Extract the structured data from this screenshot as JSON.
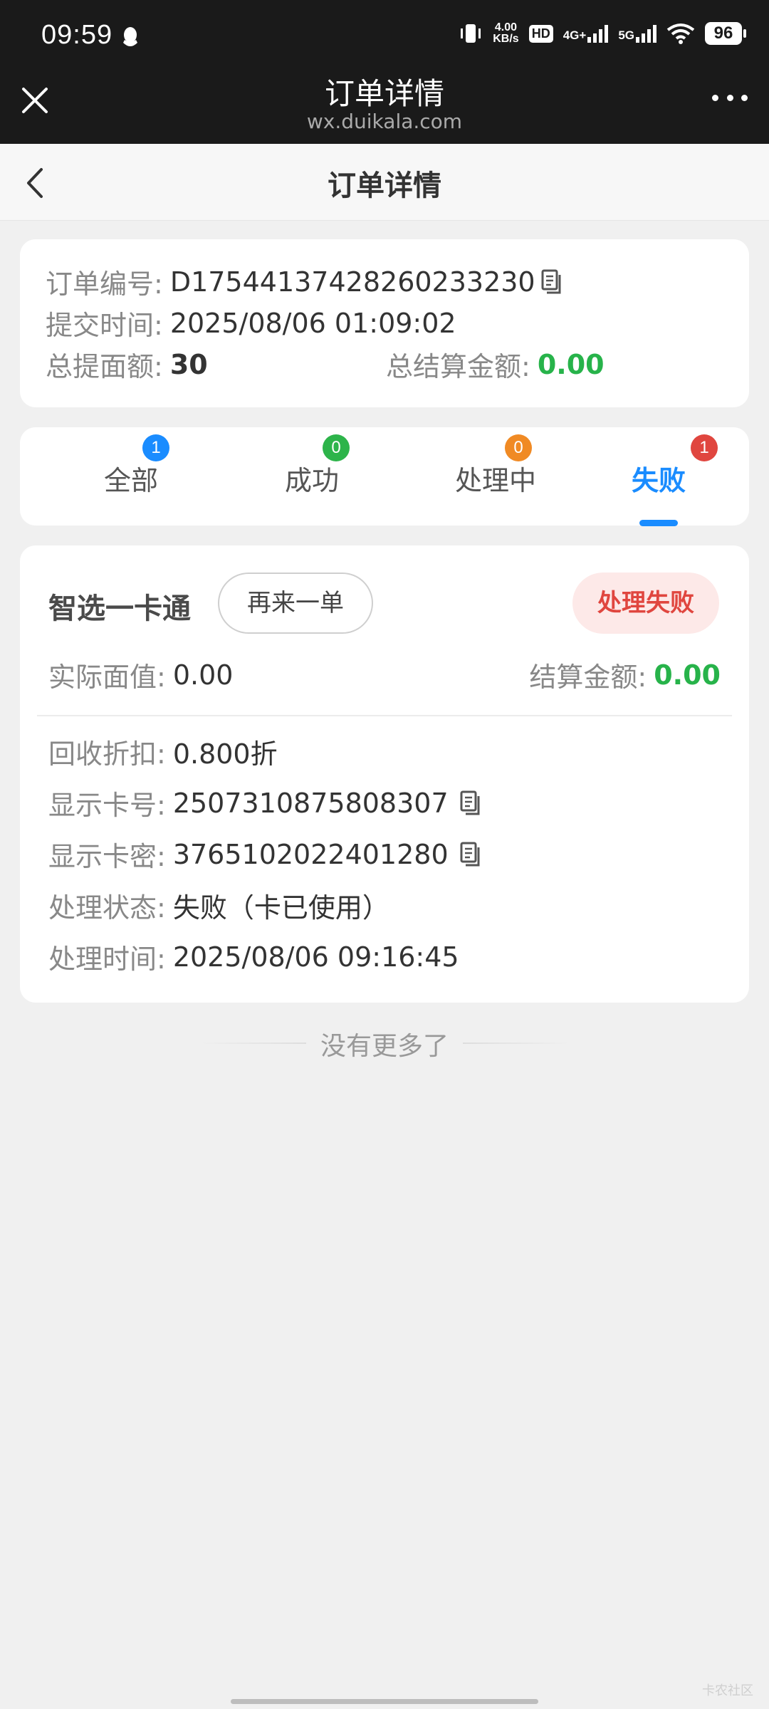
{
  "status_bar": {
    "time": "09:59",
    "net_speed_value": "4.00",
    "net_speed_unit": "KB/s",
    "hd_label": "HD",
    "sim1": "4G+",
    "sim2": "5G",
    "battery": "96"
  },
  "browser": {
    "title": "订单详情",
    "url": "wx.duikala.com"
  },
  "page": {
    "title": "订单详情"
  },
  "order_info": {
    "order_no_label": "订单编号:",
    "order_no": "D17544137428260233230",
    "submit_time_label": "提交时间:",
    "submit_time": "2025/08/06 01:09:02",
    "total_face_label": "总提面额:",
    "total_face": "30",
    "total_settle_label": "总结算金额:",
    "total_settle": "0.00"
  },
  "tabs": [
    {
      "label": "全部",
      "count": "1",
      "color": "#1a8cff"
    },
    {
      "label": "成功",
      "count": "0",
      "color": "#2db44a"
    },
    {
      "label": "处理中",
      "count": "0",
      "color": "#f08a24"
    },
    {
      "label": "失败",
      "count": "1",
      "color": "#e0463f",
      "active": true
    }
  ],
  "card": {
    "name": "智选一卡通",
    "reorder_label": "再来一单",
    "status": "处理失败",
    "actual_face_label": "实际面值:",
    "actual_face": "0.00",
    "settle_label": "结算金额:",
    "settle": "0.00",
    "discount_label": "回收折扣:",
    "discount": "0.800折",
    "card_no_label": "显示卡号:",
    "card_no": "2507310875808307",
    "card_pwd_label": "显示卡密:",
    "card_pwd": "3765102022401280",
    "state_label": "处理状态:",
    "state": "失败（卡已使用）",
    "process_time_label": "处理时间:",
    "process_time": "2025/08/06 09:16:45"
  },
  "footer": {
    "no_more": "没有更多了",
    "watermark": "卡农社区"
  },
  "colors": {
    "accent": "#1a8cff",
    "success": "#27b34a",
    "danger": "#e0463f"
  }
}
